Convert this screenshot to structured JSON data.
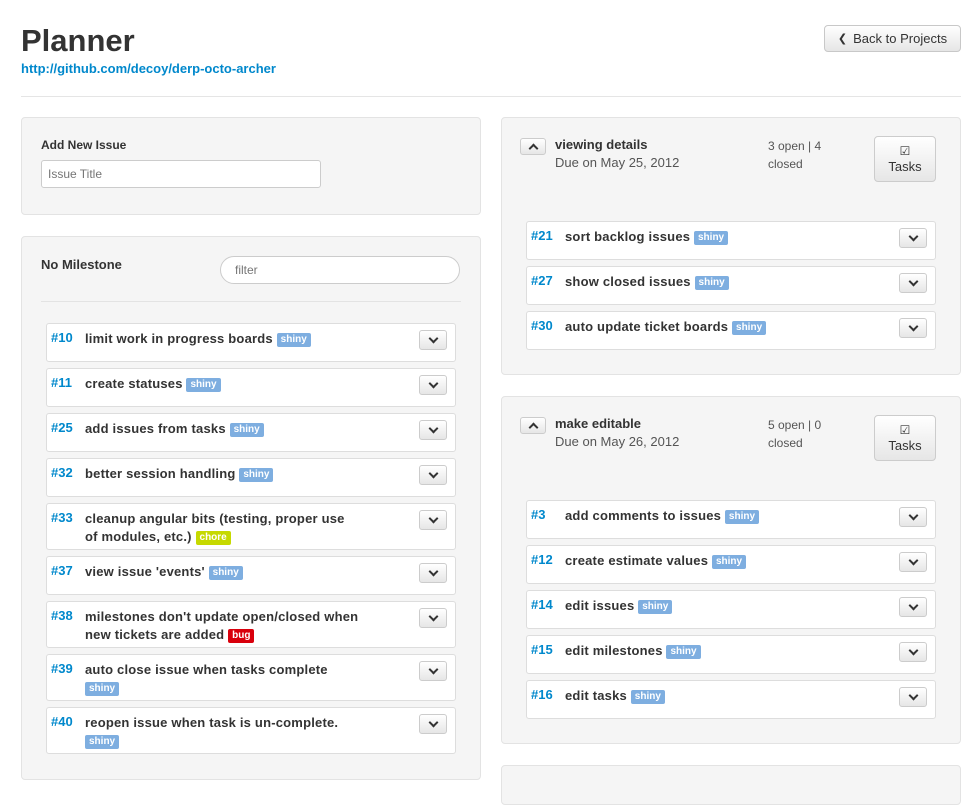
{
  "header": {
    "title": "Planner",
    "repo_url": "http://github.com/decoy/derp-octo-archer",
    "back_label": "Back to Projects"
  },
  "add_issue": {
    "label": "Add New Issue",
    "placeholder": "Issue Title"
  },
  "no_milestone": {
    "title": "No Milestone",
    "filter_placeholder": "filter",
    "issues": [
      {
        "num": "#10",
        "title": "limit work in progress boards",
        "label": "shiny"
      },
      {
        "num": "#11",
        "title": "create statuses",
        "label": "shiny"
      },
      {
        "num": "#25",
        "title": "add issues from tasks",
        "label": "shiny"
      },
      {
        "num": "#32",
        "title": "better session handling",
        "label": "shiny"
      },
      {
        "num": "#33",
        "title": "cleanup angular bits (testing, proper use of modules, etc.)",
        "label": "chore"
      },
      {
        "num": "#37",
        "title": "view issue 'events'",
        "label": "shiny"
      },
      {
        "num": "#38",
        "title": "milestones don't update open/closed when new tickets are added",
        "label": "bug"
      },
      {
        "num": "#39",
        "title": "auto close issue when tasks complete",
        "label": "shiny"
      },
      {
        "num": "#40",
        "title": "reopen issue when task is un-complete.",
        "label": "shiny"
      }
    ]
  },
  "milestones": [
    {
      "title": "viewing details",
      "due": "Due on May 25, 2012",
      "counts": "3 open | 4 closed",
      "tasks_label": "Tasks",
      "issues": [
        {
          "num": "#21",
          "title": "sort backlog issues",
          "label": "shiny"
        },
        {
          "num": "#27",
          "title": "show closed issues",
          "label": "shiny"
        },
        {
          "num": "#30",
          "title": "auto update ticket boards",
          "label": "shiny"
        }
      ]
    },
    {
      "title": "make editable",
      "due": "Due on May 26, 2012",
      "counts": "5 open | 0 closed",
      "tasks_label": "Tasks",
      "issues": [
        {
          "num": "#3",
          "title": "add comments to issues",
          "label": "shiny"
        },
        {
          "num": "#12",
          "title": "create estimate values",
          "label": "shiny"
        },
        {
          "num": "#14",
          "title": "edit issues",
          "label": "shiny"
        },
        {
          "num": "#15",
          "title": "edit milestones",
          "label": "shiny"
        },
        {
          "num": "#16",
          "title": "edit tasks",
          "label": "shiny"
        }
      ]
    }
  ],
  "colors": {
    "link": "#0088cc",
    "shiny": "#7eaee0",
    "chore": "#c6d900",
    "bug": "#d9000c"
  },
  "icons": [
    "chevron-left-icon",
    "chevron-down-icon",
    "chevron-up-icon",
    "checkbox-icon"
  ]
}
